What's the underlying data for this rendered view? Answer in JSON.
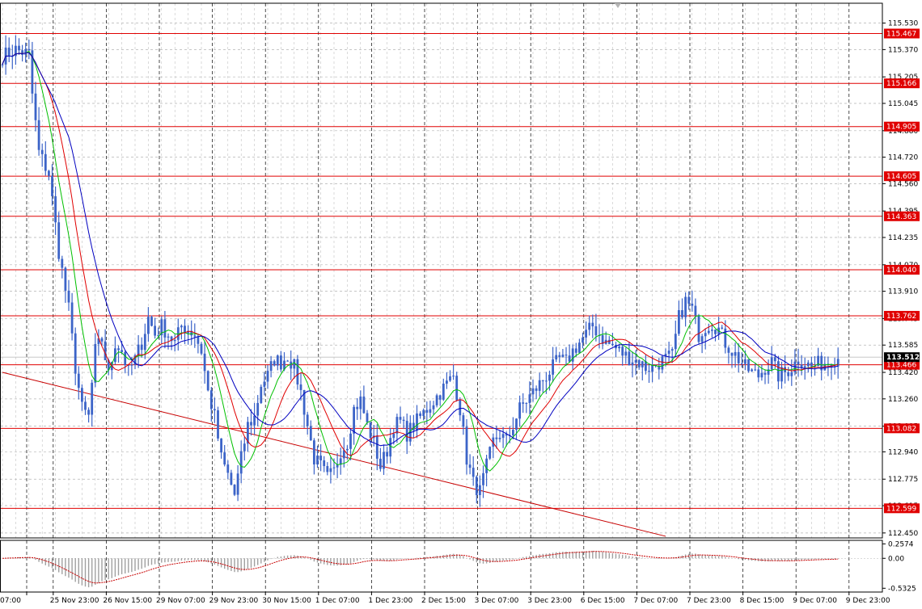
{
  "chart_data": {
    "type": "candlestick",
    "main_panel": {
      "y_ticks": [
        115.53,
        115.37,
        115.205,
        115.045,
        114.88,
        114.72,
        114.56,
        114.395,
        114.235,
        114.07,
        113.91,
        113.745,
        113.585,
        113.42,
        113.26,
        113.095,
        112.94,
        112.775,
        112.615,
        112.45
      ],
      "y_tick_labels": [
        "115.530",
        "115.370",
        "115.205",
        "115.045",
        "114.880",
        "114.720",
        "114.560",
        "114.395",
        "114.235",
        "114.070",
        "113.910",
        "113.745",
        "113.585",
        "113.420",
        "113.260",
        "113.095",
        "112.940",
        "112.775",
        "112.615",
        "112.450"
      ],
      "ylim": [
        112.42,
        115.65
      ],
      "horizontal_levels": [
        {
          "value": 115.467,
          "label": "115.467"
        },
        {
          "value": 115.166,
          "label": "115.166"
        },
        {
          "value": 114.905,
          "label": "114.905"
        },
        {
          "value": 114.605,
          "label": "114.605"
        },
        {
          "value": 114.363,
          "label": "114.363"
        },
        {
          "value": 114.04,
          "label": "114.040"
        },
        {
          "value": 113.762,
          "label": "113.762"
        },
        {
          "value": 113.466,
          "label": "113.466"
        },
        {
          "value": 113.082,
          "label": "113.082"
        },
        {
          "value": 112.599,
          "label": "112.599"
        }
      ],
      "current_price": {
        "value": 113.512,
        "label": "113.512"
      },
      "trend_line": {
        "from": {
          "bar": 0,
          "price": 113.42
        },
        "to": {
          "bar": 200,
          "price": 112.43
        }
      },
      "bar_count": 253,
      "anchors": [
        [
          0,
          115.33
        ],
        [
          4,
          115.37
        ],
        [
          8,
          115.34
        ],
        [
          9,
          115.1
        ],
        [
          11,
          114.75
        ],
        [
          14,
          114.62
        ],
        [
          17,
          114.15
        ],
        [
          20,
          113.8
        ],
        [
          22,
          113.45
        ],
        [
          24,
          113.2
        ],
        [
          26,
          113.15
        ],
        [
          28,
          113.55
        ],
        [
          30,
          113.62
        ],
        [
          32,
          113.4
        ],
        [
          34,
          113.6
        ],
        [
          36,
          113.55
        ],
        [
          38,
          113.42
        ],
        [
          40,
          113.5
        ],
        [
          42,
          113.6
        ],
        [
          44,
          113.75
        ],
        [
          46,
          113.65
        ],
        [
          48,
          113.7
        ],
        [
          50,
          113.65
        ],
        [
          52,
          113.6
        ],
        [
          54,
          113.7
        ],
        [
          56,
          113.68
        ],
        [
          58,
          113.65
        ],
        [
          60,
          113.55
        ],
        [
          62,
          113.3
        ],
        [
          64,
          113.15
        ],
        [
          66,
          112.9
        ],
        [
          68,
          112.8
        ],
        [
          70,
          112.68
        ],
        [
          72,
          112.9
        ],
        [
          74,
          113.1
        ],
        [
          76,
          113.15
        ],
        [
          78,
          113.35
        ],
        [
          80,
          113.4
        ],
        [
          82,
          113.5
        ],
        [
          84,
          113.48
        ],
        [
          86,
          113.52
        ],
        [
          88,
          113.45
        ],
        [
          90,
          113.3
        ],
        [
          92,
          113.1
        ],
        [
          94,
          112.9
        ],
        [
          96,
          112.85
        ],
        [
          98,
          112.78
        ],
        [
          100,
          112.82
        ],
        [
          102,
          112.95
        ],
        [
          104,
          113.0
        ],
        [
          106,
          113.2
        ],
        [
          108,
          113.25
        ],
        [
          110,
          113.1
        ],
        [
          112,
          113.0
        ],
        [
          114,
          112.85
        ],
        [
          116,
          112.95
        ],
        [
          118,
          113.1
        ],
        [
          120,
          113.12
        ],
        [
          122,
          113.05
        ],
        [
          124,
          113.1
        ],
        [
          126,
          113.15
        ],
        [
          128,
          113.2
        ],
        [
          130,
          113.25
        ],
        [
          132,
          113.3
        ],
        [
          134,
          113.35
        ],
        [
          136,
          113.4
        ],
        [
          138,
          113.2
        ],
        [
          140,
          112.9
        ],
        [
          142,
          112.75
        ],
        [
          144,
          112.7
        ],
        [
          146,
          112.85
        ],
        [
          148,
          113.0
        ],
        [
          150,
          113.05
        ],
        [
          152,
          113.0
        ],
        [
          154,
          113.1
        ],
        [
          156,
          113.2
        ],
        [
          158,
          113.25
        ],
        [
          160,
          113.3
        ],
        [
          162,
          113.35
        ],
        [
          164,
          113.4
        ],
        [
          166,
          113.45
        ],
        [
          168,
          113.5
        ],
        [
          170,
          113.48
        ],
        [
          172,
          113.55
        ],
        [
          174,
          113.6
        ],
        [
          176,
          113.65
        ],
        [
          178,
          113.7
        ],
        [
          180,
          113.65
        ],
        [
          182,
          113.6
        ],
        [
          184,
          113.58
        ],
        [
          186,
          113.55
        ],
        [
          188,
          113.52
        ],
        [
          190,
          113.5
        ],
        [
          192,
          113.48
        ],
        [
          194,
          113.45
        ],
        [
          196,
          113.45
        ],
        [
          198,
          113.48
        ],
        [
          200,
          113.5
        ],
        [
          202,
          113.52
        ],
        [
          204,
          113.75
        ],
        [
          206,
          113.85
        ],
        [
          208,
          113.8
        ],
        [
          210,
          113.65
        ],
        [
          212,
          113.7
        ],
        [
          214,
          113.72
        ],
        [
          216,
          113.68
        ],
        [
          218,
          113.6
        ],
        [
          220,
          113.55
        ],
        [
          222,
          113.5
        ],
        [
          224,
          113.45
        ],
        [
          226,
          113.42
        ],
        [
          228,
          113.4
        ],
        [
          230,
          113.45
        ],
        [
          232,
          113.48
        ],
        [
          234,
          113.4
        ],
        [
          236,
          113.42
        ],
        [
          238,
          113.45
        ],
        [
          240,
          113.5
        ],
        [
          242,
          113.48
        ],
        [
          244,
          113.45
        ],
        [
          246,
          113.47
        ],
        [
          248,
          113.48
        ],
        [
          250,
          113.5
        ],
        [
          252,
          113.51
        ]
      ]
    },
    "time_axis": {
      "labels": [
        {
          "bar": 0,
          "text": "07:00"
        },
        {
          "bar": 8,
          "text": "25 Nov 23:00"
        },
        {
          "bar": 24,
          "text": "26 Nov 15:00"
        },
        {
          "bar": 40,
          "text": "29 Nov 07:00"
        },
        {
          "bar": 56,
          "text": "29 Nov 23:00"
        },
        {
          "bar": 72,
          "text": "30 Nov 15:00"
        },
        {
          "bar": 88,
          "text": "1 Dec 07:00"
        },
        {
          "bar": 104,
          "text": "1 Dec 23:00"
        },
        {
          "bar": 120,
          "text": "2 Dec 15:00"
        },
        {
          "bar": 136,
          "text": "3 Dec 07:00"
        },
        {
          "bar": 152,
          "text": "3 Dec 23:00"
        },
        {
          "bar": 168,
          "text": "6 Dec 15:00"
        },
        {
          "bar": 184,
          "text": "7 Dec 07:00"
        },
        {
          "bar": 200,
          "text": "7 Dec 23:00"
        },
        {
          "bar": 216,
          "text": "8 Dec 15:00"
        },
        {
          "bar": 232,
          "text": "9 Dec 07:00"
        },
        {
          "bar": 248,
          "text": "9 Dec 23:00"
        }
      ]
    },
    "oscillator_panel": {
      "y_tick_labels": [
        "0.2574",
        "0.00",
        "-0.5325"
      ],
      "y_ticks": [
        0.2574,
        0.0,
        -0.5325
      ],
      "ylim": [
        -0.6,
        0.32
      ]
    },
    "moving_averages": [
      {
        "color": "#00c000",
        "period": 8
      },
      {
        "color": "#e00000",
        "period": 14
      },
      {
        "color": "#0000c0",
        "period": 21
      }
    ],
    "colors": {
      "candle": "#3c64c8",
      "level_line": "#e00000",
      "level_label_bg": "#e00000",
      "current_label_bg": "#000000",
      "trend_line": "#c80000",
      "oscillator": "#c80000",
      "oscillator_hist": "#a0a0a0",
      "grid": "#b4b4b4",
      "axis": "#000000"
    }
  }
}
